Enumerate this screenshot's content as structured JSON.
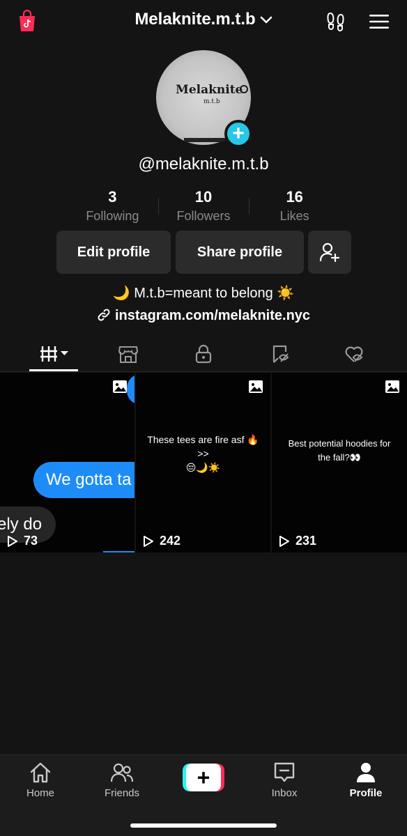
{
  "header": {
    "title": "Melaknite.m.t.b",
    "icons": {
      "shop": "shopping-bag-icon",
      "footprints": "footprints-icon",
      "menu": "hamburger-menu-icon",
      "dropdown": "chevron-down-icon"
    }
  },
  "profile": {
    "avatar_text": "Melaknite",
    "avatar_subtext": "m.t.b",
    "handle": "@melaknite.m.t.b",
    "stats": [
      {
        "value": "3",
        "label": "Following"
      },
      {
        "value": "10",
        "label": "Followers"
      },
      {
        "value": "16",
        "label": "Likes"
      }
    ],
    "edit_button": "Edit profile",
    "share_button": "Share profile",
    "bio": "🌙 M.t.b=meant to belong ☀️",
    "link": "instagram.com/melaknite.nyc"
  },
  "tabs": [
    {
      "icon": "videos-grid-icon",
      "active": true
    },
    {
      "icon": "shop-icon",
      "active": false
    },
    {
      "icon": "lock-icon",
      "active": false
    },
    {
      "icon": "repost-icon",
      "active": false
    },
    {
      "icon": "liked-heart-icon",
      "active": false
    }
  ],
  "videos": [
    {
      "views": "73",
      "bubble_blue": "We gotta ta",
      "bubble_grey": "ely do"
    },
    {
      "views": "242",
      "caption_line1": "These tees are fire asf 🔥 >>",
      "caption_line2": "😔🌙☀️"
    },
    {
      "views": "231",
      "caption_line1": "Best potential hoodies for",
      "caption_line2": "the fall?👀"
    }
  ],
  "bottom_nav": {
    "home": "Home",
    "friends": "Friends",
    "create": "+",
    "inbox": "Inbox",
    "profile": "Profile"
  },
  "colors": {
    "background": "#141414",
    "accent_cyan": "#25c8e6",
    "bubble_blue": "#1d8cf8",
    "button_bg": "#2b2b2b",
    "shop_red": "#fe2c55"
  }
}
